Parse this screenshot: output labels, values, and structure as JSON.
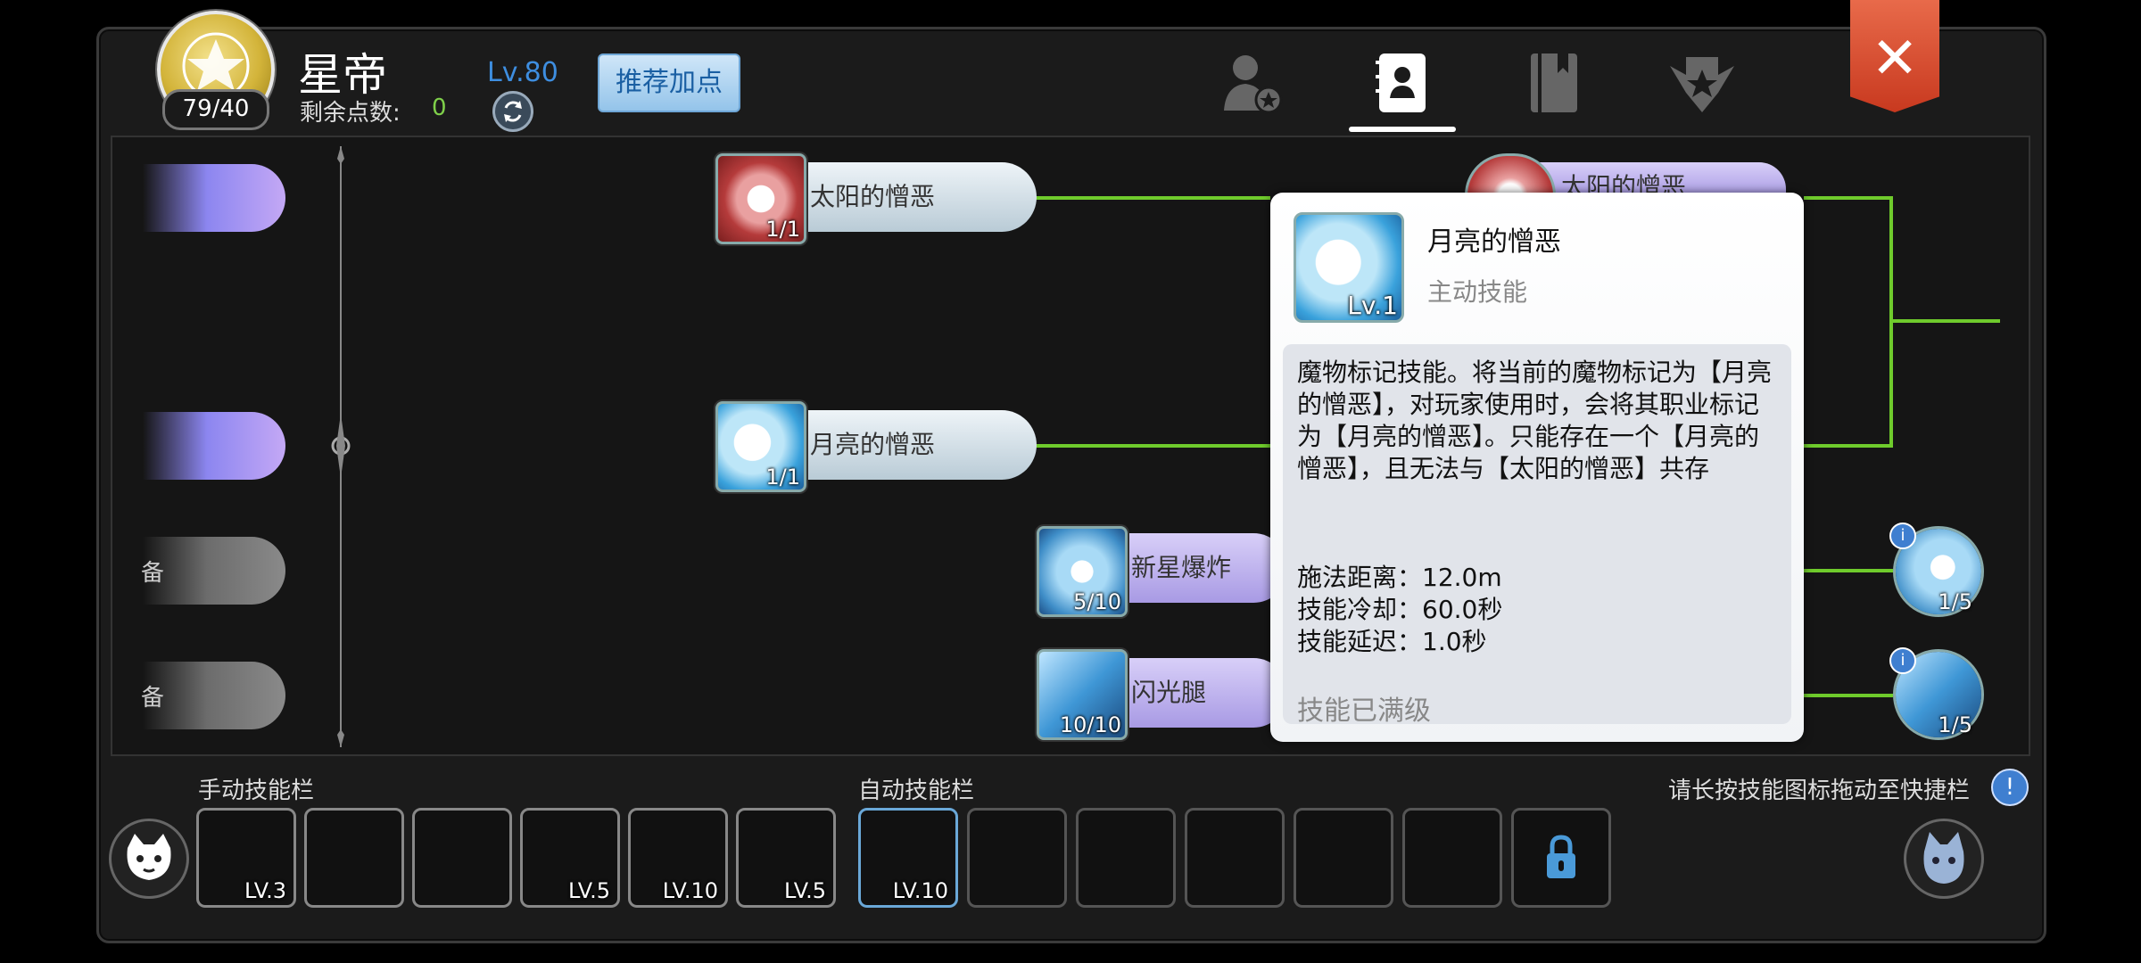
{
  "header": {
    "class_name": "星帝",
    "points_badge": "79/40",
    "remaining_label": "剩余点数:",
    "remaining_value": "0",
    "level_label": "Lv.80",
    "recommend_button": "推荐加点"
  },
  "tabs": [
    {
      "icon": "user-star-icon",
      "active": false
    },
    {
      "icon": "skill-book-icon",
      "active": true
    },
    {
      "icon": "book-icon",
      "active": false
    },
    {
      "icon": "star-badge-icon",
      "active": false
    }
  ],
  "tree": {
    "skills": [
      {
        "label": "太阳的憎恶",
        "count": "1/1",
        "icon": "sun-skill-icon"
      },
      {
        "label": "月亮的憎恶",
        "count": "1/1",
        "icon": "moon-skill-icon"
      },
      {
        "label": "新星爆炸",
        "count": "5/10",
        "icon": "nova-skill-icon"
      },
      {
        "label": "闪光腿",
        "count": "10/10",
        "icon": "flash-kick-icon"
      }
    ],
    "partial_pill_text": "太阳的憎恶",
    "left_pill_char": "备",
    "right_counts": [
      "1/5",
      "1/5"
    ]
  },
  "tooltip": {
    "name": "月亮的憎恶",
    "level": "Lv.1",
    "type": "主动技能",
    "description": "魔物标记技能。将当前的魔物标记为【月亮的憎恶】，对玩家使用时，会将其职业标记为【月亮的憎恶】。只能存在一个【月亮的憎恶】，且无法与【太阳的憎恶】共存",
    "cast_range": "施法距离：12.0m",
    "cooldown": "技能冷却：60.0秒",
    "delay": "技能延迟：1.0秒",
    "status": "技能已满级"
  },
  "bottom": {
    "manual_label": "手动技能栏",
    "auto_label": "自动技能栏",
    "hint": "请长按技能图标拖动至快捷栏",
    "manual_slots": [
      "LV.3",
      "",
      "",
      "LV.5",
      "LV.10",
      "LV.5"
    ],
    "auto_slots": [
      "LV.10"
    ]
  },
  "colors": {
    "accent_green": "#6fcb2c",
    "level_blue": "#3e8ee0",
    "close_red": "#d8472a"
  }
}
